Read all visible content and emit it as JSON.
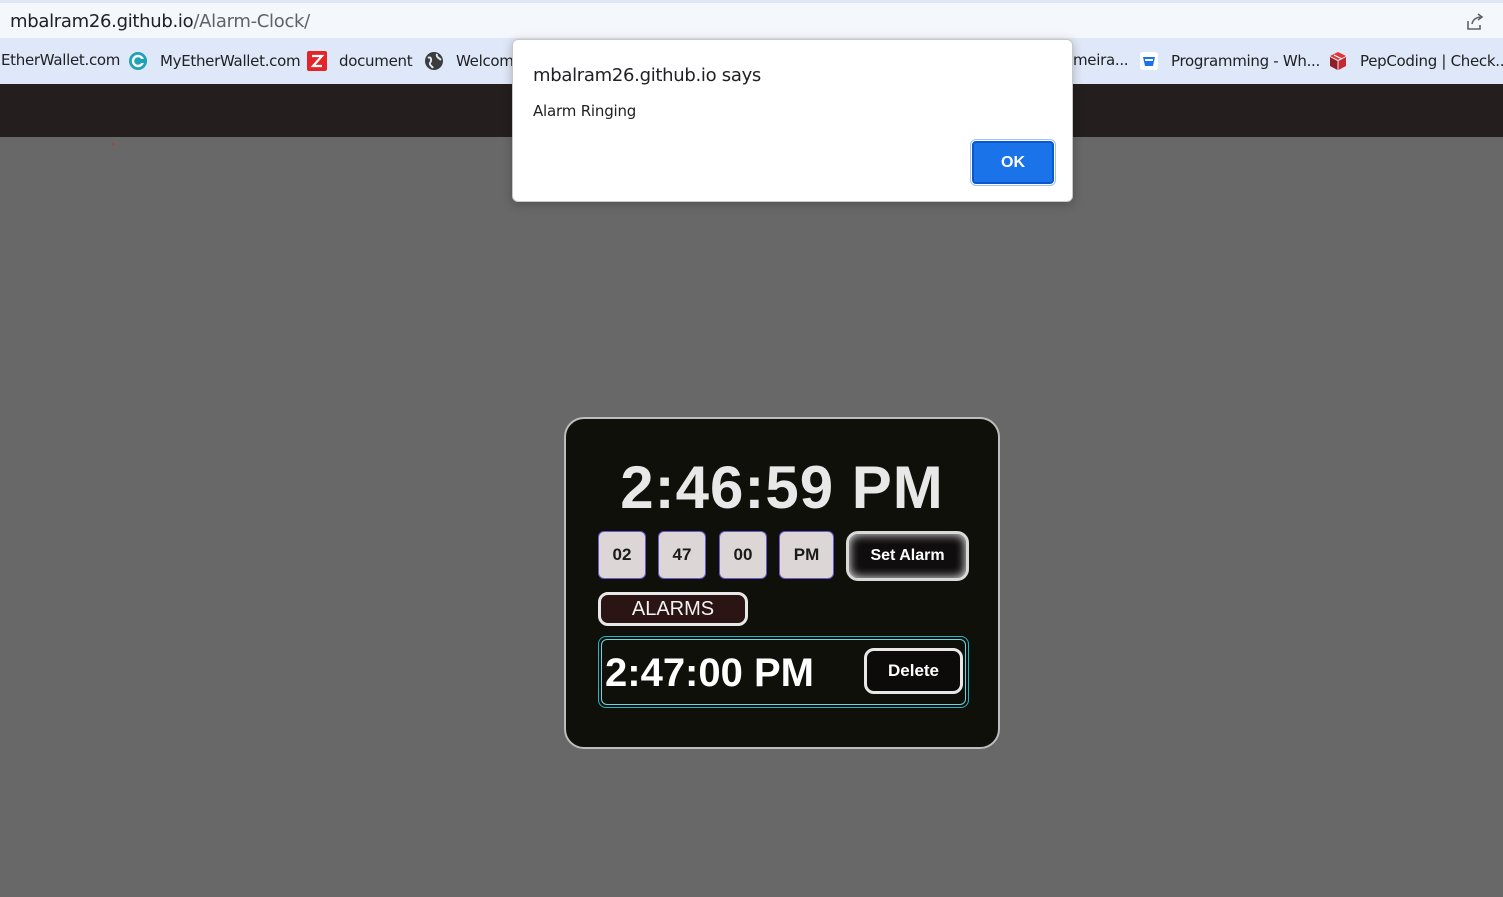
{
  "browser": {
    "url_host": "mbalram26.github.io",
    "url_path": "/Alarm-Clock/",
    "bookmarks": [
      {
        "label": "EtherWallet.com",
        "icon": "none"
      },
      {
        "label": "MyEtherWallet.com",
        "icon": "myetherwallet-icon"
      },
      {
        "label": "document",
        "icon": "zoho-z-icon"
      },
      {
        "label": "Welcome",
        "icon": "globe-icon"
      },
      {
        "label": "meira...",
        "icon": "none"
      },
      {
        "label": "Programming - Wh...",
        "icon": "shopping-bag-icon"
      },
      {
        "label": "PepCoding | Check...",
        "icon": "pepcoding-cube-icon"
      }
    ]
  },
  "dialog": {
    "title": "mbalram26.github.io says",
    "message": "Alarm Ringing",
    "ok_label": "OK"
  },
  "clock": {
    "current_time": "2:46:59 PM",
    "inputs": {
      "hour": "02",
      "minute": "47",
      "second": "00",
      "ampm": "PM"
    },
    "set_alarm_label": "Set Alarm",
    "alarms_heading": "ALARMS",
    "alarms": [
      {
        "time": "2:47:00 PM",
        "delete_label": "Delete"
      }
    ]
  },
  "colors": {
    "backdrop": "#686868",
    "card_bg": "#10100a",
    "ok_button": "#1a73e8",
    "alarm_border": "#28b4c8"
  }
}
